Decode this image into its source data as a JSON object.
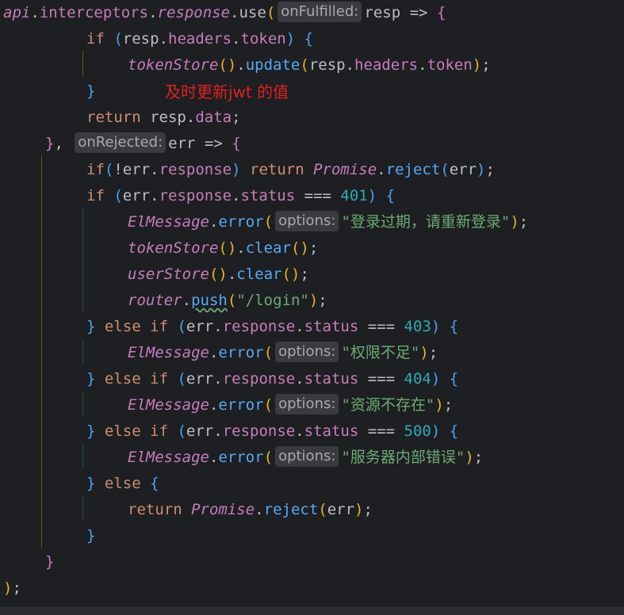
{
  "hints": {
    "on_fulfilled": "onFulfilled:",
    "on_rejected": "onRejected:",
    "options": "options:"
  },
  "code": {
    "api": "api",
    "interceptors": "interceptors",
    "response": "response",
    "use": "use",
    "resp": "resp",
    "arrow": "=>",
    "if": "if",
    "headers": "headers",
    "token": "token",
    "token_store": "tokenStore",
    "update": "update",
    "return": "return",
    "data": "data",
    "err": "err",
    "promise": "Promise",
    "reject": "reject",
    "status": "status",
    "eq": "===",
    "el_message": "ElMessage",
    "error": "error",
    "clear": "clear",
    "user_store": "userStore",
    "router": "router",
    "push": "push",
    "else": "else",
    "code_401": "401",
    "code_403": "403",
    "code_404": "404",
    "code_500": "500",
    "msg_401": "\"登录过期，请重新登录\"",
    "msg_403": "\"权限不足\"",
    "msg_404": "\"资源不存在\"",
    "msg_500": "\"服务器内部错误\"",
    "login_path": "\"/login\""
  },
  "annotation": "及时更新jwt 的值",
  "colors": {
    "background": "#1e1f22",
    "keyword": "#cf8e6d",
    "property": "#c77dbb",
    "method": "#56a8f5",
    "string": "#6aab73",
    "number": "#2aacb8",
    "annotation": "#e02020"
  }
}
